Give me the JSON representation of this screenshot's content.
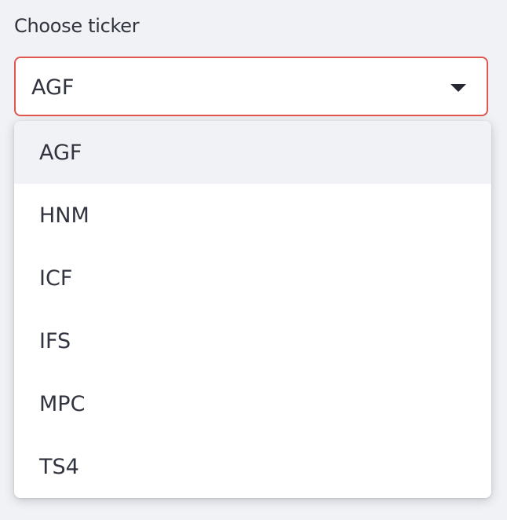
{
  "label": "Choose ticker",
  "select": {
    "value": "AGF",
    "focus_color": "#e0574f"
  },
  "options": [
    "AGF",
    "HNM",
    "ICF",
    "IFS",
    "MPC",
    "TS4"
  ],
  "highlighted_option": "AGF",
  "colors": {
    "background": "#f0f2f6",
    "text": "#31333f",
    "highlight": "#f0f2f6"
  }
}
